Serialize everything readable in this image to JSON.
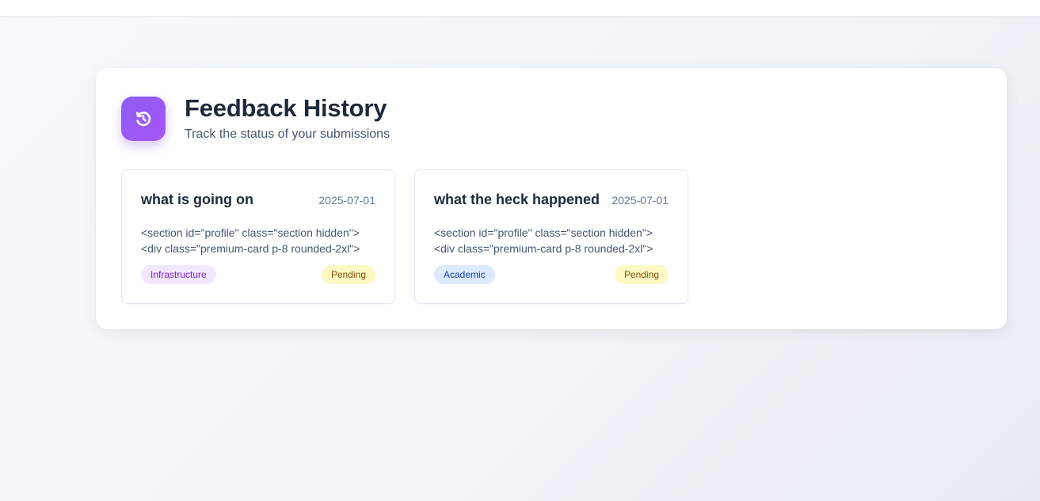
{
  "header": {
    "title": "Feedback History",
    "subtitle": "Track the status of your submissions",
    "icon": "history-icon"
  },
  "colors": {
    "accent_from": "#8b5cf6",
    "accent_to": "#a855f7",
    "pending_bg": "#fef9c3",
    "pending_text": "#854d0e",
    "infrastructure_bg": "#f3e8ff",
    "infrastructure_text": "#7e22ce",
    "academic_bg": "#dbeafe",
    "academic_text": "#1e40af"
  },
  "feedback": [
    {
      "title": "what is going on",
      "date": "2025-07-01",
      "body": "<section id=\"profile\" class=\"section hidden\"> <div class=\"premium-card p-8 rounded-2xl\">",
      "category": "Infrastructure",
      "status": "Pending"
    },
    {
      "title": "what the heck happened",
      "date": "2025-07-01",
      "body": "<section id=\"profile\" class=\"section hidden\"> <div class=\"premium-card p-8 rounded-2xl\">",
      "category": "Academic",
      "status": "Pending"
    }
  ]
}
